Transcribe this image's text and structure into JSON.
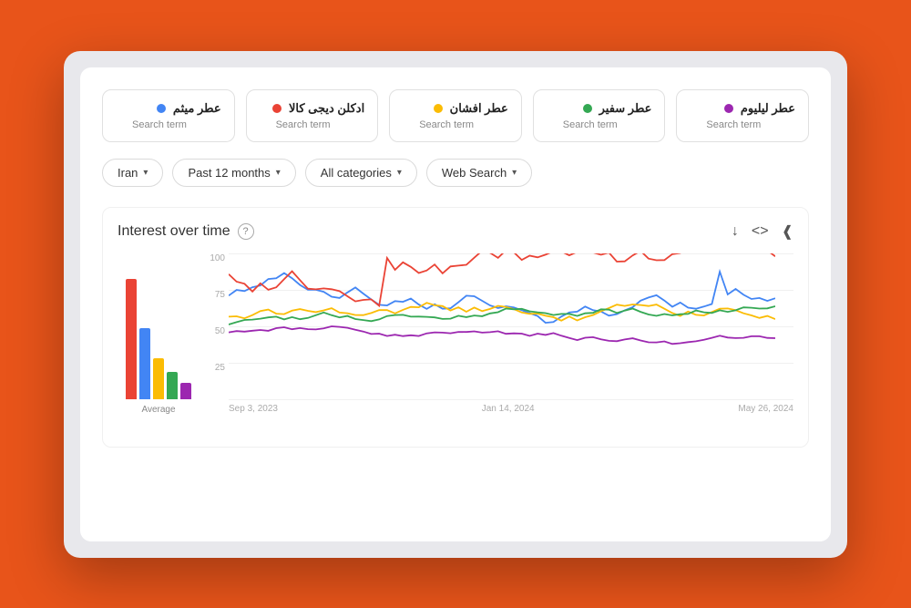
{
  "background_color": "#E8541A",
  "search_terms": [
    {
      "id": 1,
      "text": "عطر میثم",
      "label": "Search term",
      "color": "#4285F4"
    },
    {
      "id": 2,
      "text": "ادکلن دیجی کالا",
      "label": "Search term",
      "color": "#EA4335"
    },
    {
      "id": 3,
      "text": "عطر افشان",
      "label": "Search term",
      "color": "#FBBC04"
    },
    {
      "id": 4,
      "text": "عطر سفیر",
      "label": "Search term",
      "color": "#34A853"
    },
    {
      "id": 5,
      "text": "عطر لیلیوم",
      "label": "Search term",
      "color": "#9C27B0"
    }
  ],
  "filters": [
    {
      "id": "region",
      "label": "Iran",
      "has_arrow": true
    },
    {
      "id": "time",
      "label": "Past 12 months",
      "has_arrow": true
    },
    {
      "id": "category",
      "label": "All categories",
      "has_arrow": true
    },
    {
      "id": "search_type",
      "label": "Web Search",
      "has_arrow": true
    }
  ],
  "chart": {
    "title": "Interest over time",
    "help_tooltip": "?",
    "average_label": "Average",
    "x_labels": [
      "Sep 3, 2023",
      "Jan 14, 2024",
      "May 26, 2024"
    ],
    "y_labels": [
      "100",
      "75",
      "50",
      "25",
      ""
    ],
    "bars": [
      {
        "color": "#EA4335",
        "height_pct": 88
      },
      {
        "color": "#4285F4",
        "height_pct": 52
      },
      {
        "color": "#FBBC04",
        "height_pct": 30
      },
      {
        "color": "#34A853",
        "height_pct": 20
      },
      {
        "color": "#9C27B0",
        "height_pct": 12
      }
    ]
  }
}
